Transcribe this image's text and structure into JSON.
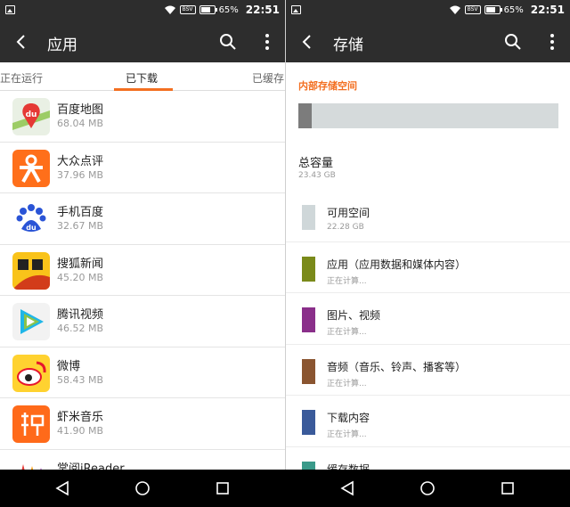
{
  "status_bar": {
    "battery_saver": "BSV",
    "battery_percent": "65%",
    "time": "22:51"
  },
  "apps_screen": {
    "title": "应用",
    "tabs": [
      {
        "label": "正在运行"
      },
      {
        "label": "已下载",
        "active": true
      },
      {
        "label": "已缓存"
      }
    ],
    "apps": [
      {
        "name": "百度地图",
        "size": "68.04 MB",
        "icon": "baidu-map-icon"
      },
      {
        "name": "大众点评",
        "size": "37.96 MB",
        "icon": "dianping-icon"
      },
      {
        "name": "手机百度",
        "size": "32.67 MB",
        "icon": "baidu-icon"
      },
      {
        "name": "搜狐新闻",
        "size": "45.20 MB",
        "icon": "sohu-news-icon"
      },
      {
        "name": "腾讯视频",
        "size": "46.52 MB",
        "icon": "tencent-video-icon"
      },
      {
        "name": "微博",
        "size": "58.43 MB",
        "icon": "weibo-icon"
      },
      {
        "name": "虾米音乐",
        "size": "41.90 MB",
        "icon": "xiami-music-icon"
      },
      {
        "name": "掌阅iReader",
        "size": "",
        "icon": "ireader-icon"
      }
    ]
  },
  "storage_screen": {
    "title": "存储",
    "section_title": "内部存储空间",
    "used_fraction": 0.05,
    "total_label": "总容量",
    "total_value": "23.43 GB",
    "categories": [
      {
        "label": "可用空间",
        "sub": "22.28 GB",
        "color": "#cfd7d9"
      },
      {
        "label": "应用（应用数据和媒体内容）",
        "sub": "正在计算...",
        "color": "#7a8a1a"
      },
      {
        "label": "图片、视频",
        "sub": "正在计算...",
        "color": "#8a2f8a"
      },
      {
        "label": "音频（音乐、铃声、播客等）",
        "sub": "正在计算...",
        "color": "#8a5530"
      },
      {
        "label": "下载内容",
        "sub": "正在计算...",
        "color": "#3a5a9a"
      },
      {
        "label": "缓存数据",
        "sub": "",
        "color": "#3a9a8a"
      }
    ]
  },
  "colors": {
    "accent": "#f36f21",
    "appbar": "#2d2d2d"
  }
}
